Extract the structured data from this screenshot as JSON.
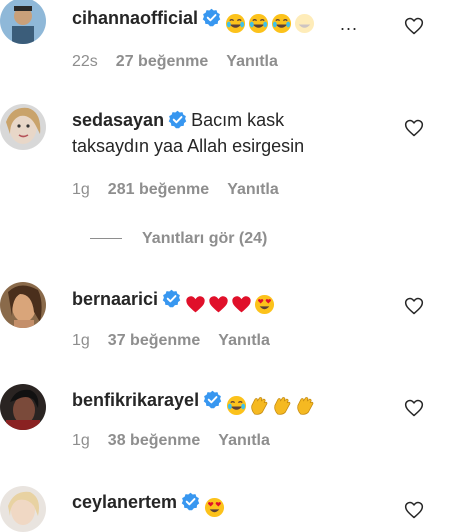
{
  "comments": [
    {
      "username": "cihannaofficial",
      "text": "",
      "time": "22s",
      "likes": "27 beğenme",
      "reply": "Yanıtla",
      "emojis": [
        "joy",
        "joy",
        "joy",
        "joy-faded"
      ]
    },
    {
      "username": "sedasayan",
      "text_line1": "Bacım kask",
      "text_line2": "taksaydın yaa Allah esirgesin",
      "time": "1g",
      "likes": "281 beğenme",
      "reply": "Yanıtla"
    },
    {
      "username": "bernaarici",
      "text": "",
      "time": "1g",
      "likes": "37 beğenme",
      "reply": "Yanıtla",
      "emojis": [
        "red-heart",
        "red-heart",
        "red-heart",
        "heart-eyes"
      ]
    },
    {
      "username": "benfikrikarayel",
      "text": "",
      "time": "1g",
      "likes": "38 beğenme",
      "reply": "Yanıtla",
      "emojis": [
        "joy",
        "clap",
        "clap",
        "clap"
      ]
    },
    {
      "username": "ceylanertem",
      "text": "",
      "emojis": [
        "heart-eyes"
      ]
    }
  ],
  "view_replies": "Yanıtları gör (24)",
  "more_indicator": "...",
  "colors": {
    "verified": "#3897f0",
    "muted": "#8e8e8e",
    "text": "#262626"
  },
  "icons": {
    "like": "heart-outline-icon",
    "verified": "verified-badge-icon"
  }
}
